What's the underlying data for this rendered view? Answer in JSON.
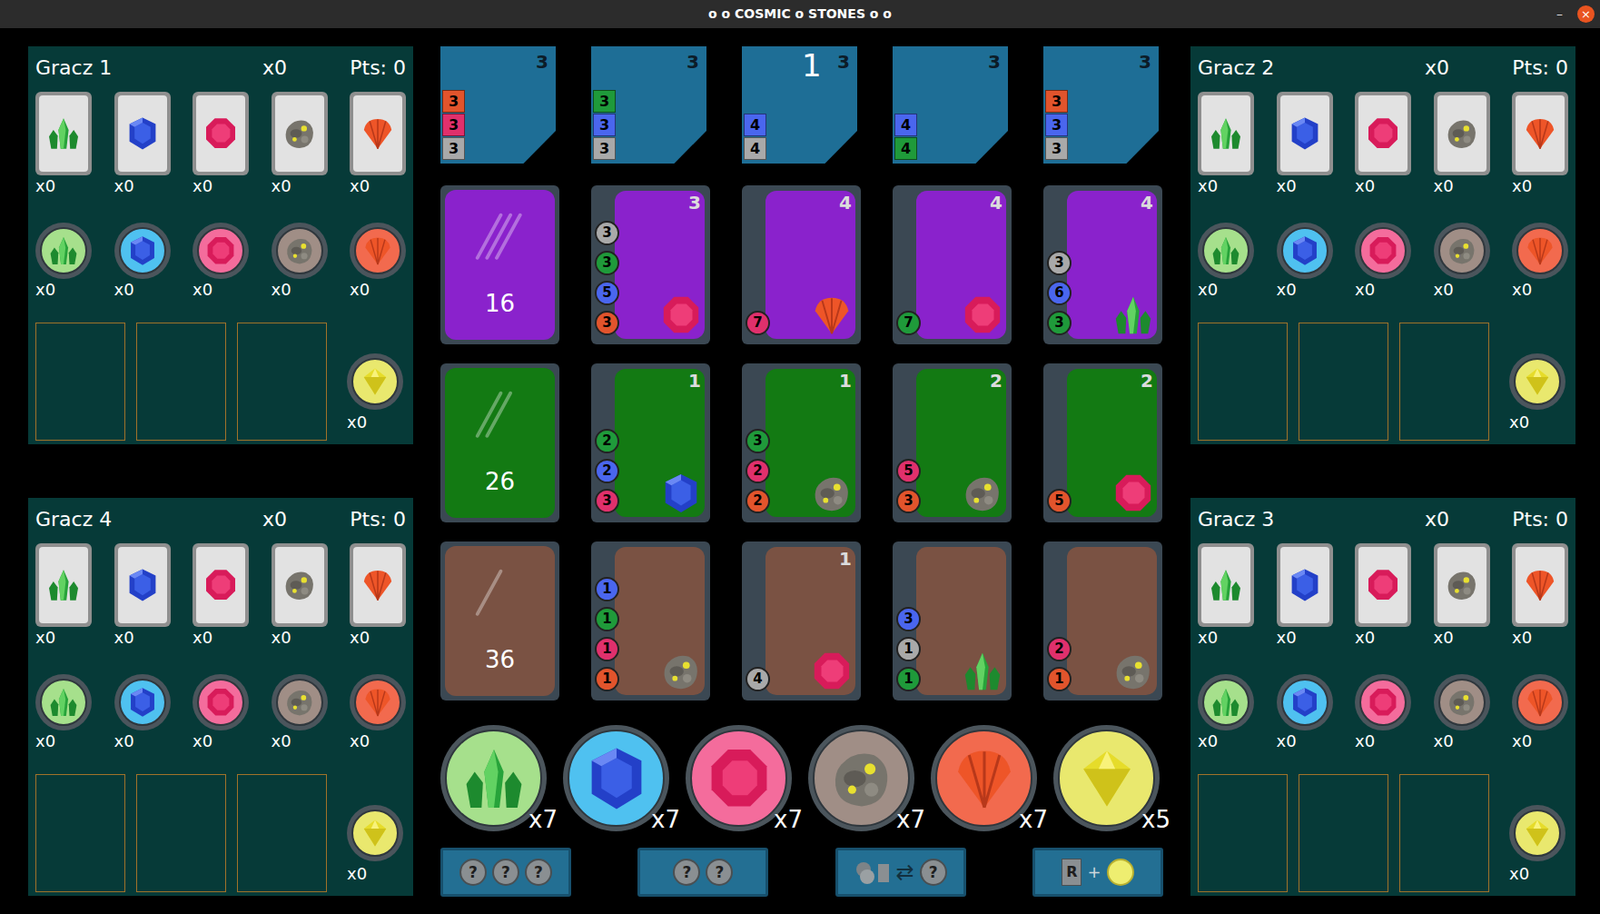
{
  "window": {
    "title": "o o COSMIC o STONES o o",
    "controls": [
      "–",
      "×"
    ]
  },
  "turn": "1",
  "players": [
    {
      "name": "Gracz 1",
      "count": "x0",
      "points": "Pts: 0",
      "cards": [
        {
          "kind": "emerald",
          "count": "x0"
        },
        {
          "kind": "sapphire",
          "count": "x0"
        },
        {
          "kind": "ruby",
          "count": "x0"
        },
        {
          "kind": "meteorite",
          "count": "x0"
        },
        {
          "kind": "coral",
          "count": "x0"
        }
      ],
      "tokens": [
        {
          "kind": "emerald",
          "count": "x0"
        },
        {
          "kind": "sapphire",
          "count": "x0"
        },
        {
          "kind": "ruby",
          "count": "x0"
        },
        {
          "kind": "meteorite",
          "count": "x0"
        },
        {
          "kind": "coral",
          "count": "x0"
        }
      ],
      "gold": "x0"
    },
    {
      "name": "Gracz 2",
      "count": "x0",
      "points": "Pts: 0",
      "cards": [
        {
          "kind": "emerald",
          "count": "x0"
        },
        {
          "kind": "sapphire",
          "count": "x0"
        },
        {
          "kind": "ruby",
          "count": "x0"
        },
        {
          "kind": "meteorite",
          "count": "x0"
        },
        {
          "kind": "coral",
          "count": "x0"
        }
      ],
      "tokens": [
        {
          "kind": "emerald",
          "count": "x0"
        },
        {
          "kind": "sapphire",
          "count": "x0"
        },
        {
          "kind": "ruby",
          "count": "x0"
        },
        {
          "kind": "meteorite",
          "count": "x0"
        },
        {
          "kind": "coral",
          "count": "x0"
        }
      ],
      "gold": "x0"
    },
    {
      "name": "Gracz 3",
      "count": "x0",
      "points": "Pts: 0",
      "cards": [
        {
          "kind": "emerald",
          "count": "x0"
        },
        {
          "kind": "sapphire",
          "count": "x0"
        },
        {
          "kind": "ruby",
          "count": "x0"
        },
        {
          "kind": "meteorite",
          "count": "x0"
        },
        {
          "kind": "coral",
          "count": "x0"
        }
      ],
      "tokens": [
        {
          "kind": "emerald",
          "count": "x0"
        },
        {
          "kind": "sapphire",
          "count": "x0"
        },
        {
          "kind": "ruby",
          "count": "x0"
        },
        {
          "kind": "meteorite",
          "count": "x0"
        },
        {
          "kind": "coral",
          "count": "x0"
        }
      ],
      "gold": "x0"
    },
    {
      "name": "Gracz 4",
      "count": "x0",
      "points": "Pts: 0",
      "cards": [
        {
          "kind": "emerald",
          "count": "x0"
        },
        {
          "kind": "sapphire",
          "count": "x0"
        },
        {
          "kind": "ruby",
          "count": "x0"
        },
        {
          "kind": "meteorite",
          "count": "x0"
        },
        {
          "kind": "coral",
          "count": "x0"
        }
      ],
      "tokens": [
        {
          "kind": "emerald",
          "count": "x0"
        },
        {
          "kind": "sapphire",
          "count": "x0"
        },
        {
          "kind": "ruby",
          "count": "x0"
        },
        {
          "kind": "meteorite",
          "count": "x0"
        },
        {
          "kind": "coral",
          "count": "x0"
        }
      ],
      "gold": "x0"
    }
  ],
  "nobles": [
    {
      "points": "3",
      "requirements": [
        {
          "kind": "coral",
          "count": "3"
        },
        {
          "kind": "ruby",
          "count": "3"
        },
        {
          "kind": "meteorite",
          "count": "3"
        }
      ]
    },
    {
      "points": "3",
      "requirements": [
        {
          "kind": "emerald",
          "count": "3"
        },
        {
          "kind": "sapphire",
          "count": "3"
        },
        {
          "kind": "meteorite",
          "count": "3"
        }
      ]
    },
    {
      "points": "3",
      "requirements": [
        {
          "kind": "sapphire",
          "count": "4"
        },
        {
          "kind": "meteorite",
          "count": "4"
        }
      ]
    },
    {
      "points": "3",
      "requirements": [
        {
          "kind": "sapphire",
          "count": "4"
        },
        {
          "kind": "emerald",
          "count": "4"
        }
      ]
    },
    {
      "points": "3",
      "requirements": [
        {
          "kind": "coral",
          "count": "3"
        },
        {
          "kind": "sapphire",
          "count": "3"
        },
        {
          "kind": "meteorite",
          "count": "3"
        }
      ]
    }
  ],
  "rows": [
    {
      "level": 3,
      "color": "#8a22cc",
      "deck_count": "16",
      "cards": [
        {
          "points": "3",
          "gem": "ruby",
          "costs": [
            {
              "kind": "meteorite",
              "count": "3"
            },
            {
              "kind": "emerald",
              "count": "3"
            },
            {
              "kind": "sapphire",
              "count": "5"
            },
            {
              "kind": "coral",
              "count": "3"
            }
          ]
        },
        {
          "points": "4",
          "gem": "coral",
          "costs": [
            {
              "kind": "ruby",
              "count": "7"
            }
          ]
        },
        {
          "points": "4",
          "gem": "ruby",
          "costs": [
            {
              "kind": "emerald",
              "count": "7"
            }
          ]
        },
        {
          "points": "4",
          "gem": "emerald",
          "costs": [
            {
              "kind": "meteorite",
              "count": "3"
            },
            {
              "kind": "sapphire",
              "count": "6"
            },
            {
              "kind": "emerald",
              "count": "3"
            }
          ]
        }
      ]
    },
    {
      "level": 2,
      "color": "#137a13",
      "deck_count": "26",
      "cards": [
        {
          "points": "1",
          "gem": "sapphire",
          "costs": [
            {
              "kind": "emerald",
              "count": "2"
            },
            {
              "kind": "sapphire",
              "count": "2"
            },
            {
              "kind": "ruby",
              "count": "3"
            }
          ]
        },
        {
          "points": "1",
          "gem": "meteorite",
          "costs": [
            {
              "kind": "emerald",
              "count": "3"
            },
            {
              "kind": "ruby",
              "count": "2"
            },
            {
              "kind": "coral",
              "count": "2"
            }
          ]
        },
        {
          "points": "2",
          "gem": "meteorite",
          "costs": [
            {
              "kind": "ruby",
              "count": "5"
            },
            {
              "kind": "coral",
              "count": "3"
            }
          ]
        },
        {
          "points": "2",
          "gem": "ruby",
          "costs": [
            {
              "kind": "coral",
              "count": "5"
            }
          ]
        }
      ]
    },
    {
      "level": 1,
      "color": "#7a5243",
      "deck_count": "36",
      "cards": [
        {
          "gem": "meteorite",
          "costs": [
            {
              "kind": "sapphire",
              "count": "1"
            },
            {
              "kind": "emerald",
              "count": "1"
            },
            {
              "kind": "ruby",
              "count": "1"
            },
            {
              "kind": "coral",
              "count": "1"
            }
          ]
        },
        {
          "points": "1",
          "gem": "ruby",
          "costs": [
            {
              "kind": "meteorite",
              "count": "4"
            }
          ]
        },
        {
          "gem": "emerald",
          "costs": [
            {
              "kind": "sapphire",
              "count": "3"
            },
            {
              "kind": "meteorite",
              "count": "1"
            },
            {
              "kind": "emerald",
              "count": "1"
            }
          ]
        },
        {
          "gem": "meteorite",
          "costs": [
            {
              "kind": "ruby",
              "count": "2"
            },
            {
              "kind": "coral",
              "count": "1"
            }
          ]
        }
      ]
    }
  ],
  "bank": [
    {
      "kind": "emerald",
      "count": "x7"
    },
    {
      "kind": "sapphire",
      "count": "x7"
    },
    {
      "kind": "ruby",
      "count": "x7"
    },
    {
      "kind": "meteorite",
      "count": "x7"
    },
    {
      "kind": "coral",
      "count": "x7"
    },
    {
      "kind": "gold",
      "count": "x5"
    }
  ],
  "actions": [
    {
      "kind": "take-three",
      "labels": [
        "?",
        "?",
        "?"
      ]
    },
    {
      "kind": "take-two",
      "labels": [
        "?",
        "?"
      ]
    },
    {
      "kind": "exchange",
      "labels": [
        "⇄",
        "?"
      ]
    },
    {
      "kind": "reserve",
      "labels": [
        "R",
        "+"
      ]
    }
  ]
}
